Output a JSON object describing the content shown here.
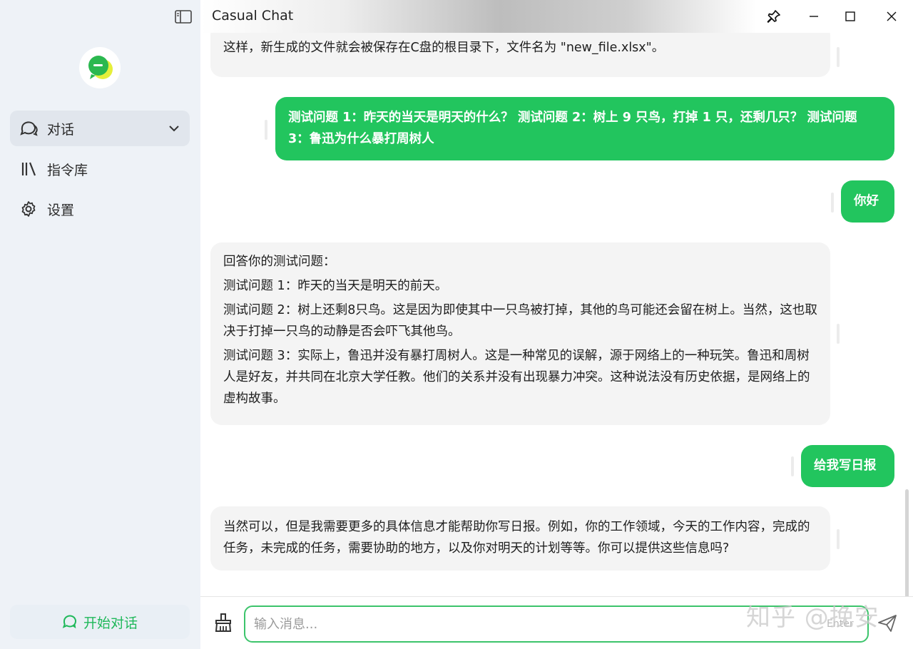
{
  "app": {
    "title": "Casual Chat",
    "brand_color": "#22c55e"
  },
  "sidebar": {
    "toggle_icon": "sidebar-toggle-icon",
    "logo_icon": "chat-logo-icon",
    "items": [
      {
        "label": "对话",
        "icon": "chat-bubbles-icon",
        "active": true,
        "expandable": true
      },
      {
        "label": "指令库",
        "icon": "library-icon",
        "active": false
      },
      {
        "label": "设置",
        "icon": "gear-icon",
        "active": false
      }
    ],
    "new_chat_label": "开始对话"
  },
  "window_controls": [
    "pin-icon",
    "minimize-icon",
    "maximize-icon",
    "close-icon"
  ],
  "messages": [
    {
      "role": "assistant",
      "paragraphs": [
        "这样，新生成的文件就会被保存在C盘的根目录下，文件名为 \"new_file.xlsx\"。"
      ]
    },
    {
      "role": "user",
      "text": "测试问题 1：昨天的当天是明天的什么？ 测试问题 2：树上 9 只鸟，打掉 1 只，还剩几只？ 测试问题 3：鲁迅为什么暴打周树人"
    },
    {
      "role": "user",
      "text": "你好"
    },
    {
      "role": "assistant",
      "paragraphs": [
        "回答你的测试问题：",
        "测试问题 1：昨天的当天是明天的前天。",
        "测试问题 2：树上还剩8只鸟。这是因为即使其中一只鸟被打掉，其他的鸟可能还会留在树上。当然，这也取决于打掉一只鸟的动静是否会吓飞其他鸟。",
        "测试问题 3：实际上，鲁迅并没有暴打周树人。这是一种常见的误解，源于网络上的一种玩笑。鲁迅和周树人是好友，并共同在北京大学任教。他们的关系并没有出现暴力冲突。这种说法没有历史依据，是网络上的虚构故事。"
      ]
    },
    {
      "role": "user",
      "text": "给我写日报"
    },
    {
      "role": "assistant",
      "paragraphs": [
        "当然可以，但是我需要更多的具体信息才能帮助你写日报。例如，你的工作领域，今天的工作内容，完成的任务，未完成的任务，需要协助的地方，以及你对明天的计划等等。你可以提供这些信息吗?"
      ]
    }
  ],
  "input": {
    "placeholder": "输入消息...",
    "value": "",
    "enter_hint": "Enter",
    "clear_icon": "broom-icon",
    "send_icon": "send-icon"
  },
  "watermark": "知乎 @挽安"
}
